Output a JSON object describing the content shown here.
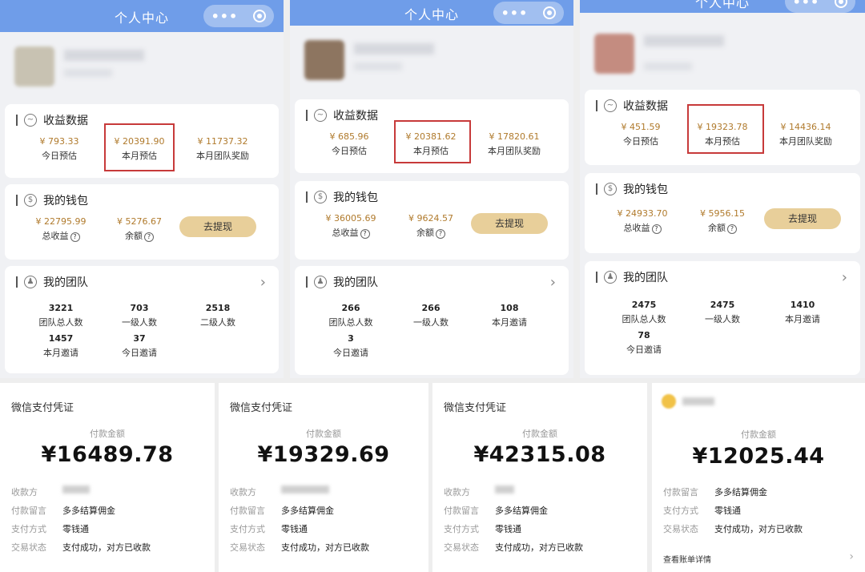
{
  "panels": [
    {
      "title": "个人中心",
      "income_title": "收益数据",
      "income": [
        {
          "value": "¥ 793.33",
          "label": "今日预估"
        },
        {
          "value": "¥ 20391.90",
          "label": "本月预估"
        },
        {
          "value": "¥ 11737.32",
          "label": "本月团队奖励"
        }
      ],
      "wallet_title": "我的钱包",
      "wallet": [
        {
          "value": "¥ 22795.99",
          "label": "总收益"
        },
        {
          "value": "¥ 5276.67",
          "label": "余额"
        }
      ],
      "withdraw_label": "去提现",
      "team_title": "我的团队",
      "team": [
        {
          "value": "3221",
          "label": "团队总人数"
        },
        {
          "value": "703",
          "label": "一级人数"
        },
        {
          "value": "2518",
          "label": "二级人数"
        },
        {
          "value": "1457",
          "label": "本月邀请"
        },
        {
          "value": "37",
          "label": "今日邀请"
        }
      ]
    },
    {
      "title": "个人中心",
      "income_title": "收益数据",
      "income": [
        {
          "value": "¥ 685.96",
          "label": "今日预估"
        },
        {
          "value": "¥ 20381.62",
          "label": "本月预估"
        },
        {
          "value": "¥ 17820.61",
          "label": "本月团队奖励"
        }
      ],
      "wallet_title": "我的钱包",
      "wallet": [
        {
          "value": "¥ 36005.69",
          "label": "总收益"
        },
        {
          "value": "¥ 9624.57",
          "label": "余额"
        }
      ],
      "withdraw_label": "去提现",
      "team_title": "我的团队",
      "team": [
        {
          "value": "266",
          "label": "团队总人数"
        },
        {
          "value": "266",
          "label": "一级人数"
        },
        {
          "value": "108",
          "label": "本月邀请"
        },
        {
          "value": "3",
          "label": "今日邀请"
        }
      ]
    },
    {
      "title": "个人中心",
      "income_title": "收益数据",
      "income": [
        {
          "value": "¥ 451.59",
          "label": "今日预估"
        },
        {
          "value": "¥ 19323.78",
          "label": "本月预估"
        },
        {
          "value": "¥ 14436.14",
          "label": "本月团队奖励"
        }
      ],
      "wallet_title": "我的钱包",
      "wallet": [
        {
          "value": "¥ 24933.70",
          "label": "总收益"
        },
        {
          "value": "¥ 5956.15",
          "label": "余额"
        }
      ],
      "withdraw_label": "去提现",
      "team_title": "我的团队",
      "team": [
        {
          "value": "2475",
          "label": "团队总人数"
        },
        {
          "value": "2475",
          "label": "一级人数"
        },
        {
          "value": "1410",
          "label": "本月邀请"
        },
        {
          "value": "78",
          "label": "今日邀请"
        }
      ]
    }
  ],
  "receipts": [
    {
      "title": "微信支付凭证",
      "amount_label": "付款金额",
      "amount": "¥16489.78",
      "rows": [
        {
          "k": "收款方",
          "v": ""
        },
        {
          "k": "付款留言",
          "v": "多多结算佣金"
        },
        {
          "k": "支付方式",
          "v": "零钱通"
        },
        {
          "k": "交易状态",
          "v": "支付成功，对方已收款"
        }
      ]
    },
    {
      "title": "微信支付凭证",
      "amount_label": "付款金额",
      "amount": "¥19329.69",
      "rows": [
        {
          "k": "收款方",
          "v": ""
        },
        {
          "k": "付款留言",
          "v": "多多结算佣金"
        },
        {
          "k": "支付方式",
          "v": "零钱通"
        },
        {
          "k": "交易状态",
          "v": "支付成功，对方已收款"
        }
      ]
    },
    {
      "title": "微信支付凭证",
      "amount_label": "付款金额",
      "amount": "¥42315.08",
      "rows": [
        {
          "k": "收款方",
          "v": ""
        },
        {
          "k": "付款留言",
          "v": "多多结算佣金"
        },
        {
          "k": "支付方式",
          "v": "零钱通"
        },
        {
          "k": "交易状态",
          "v": "支付成功，对方已收款"
        }
      ]
    },
    {
      "title": "",
      "amount_label": "付款金额",
      "amount": "¥12025.44",
      "rows": [
        {
          "k": "付款留言",
          "v": "多多结算佣金"
        },
        {
          "k": "支付方式",
          "v": "零钱通"
        },
        {
          "k": "交易状态",
          "v": "支付成功，对方已收款"
        }
      ],
      "detail_link": "查看账单详情"
    }
  ],
  "colors": {
    "titlebar": "#6f9de9",
    "accent": "#b07a2c",
    "withdraw": "#e8cf9a",
    "highlight": "#c73a3a"
  }
}
